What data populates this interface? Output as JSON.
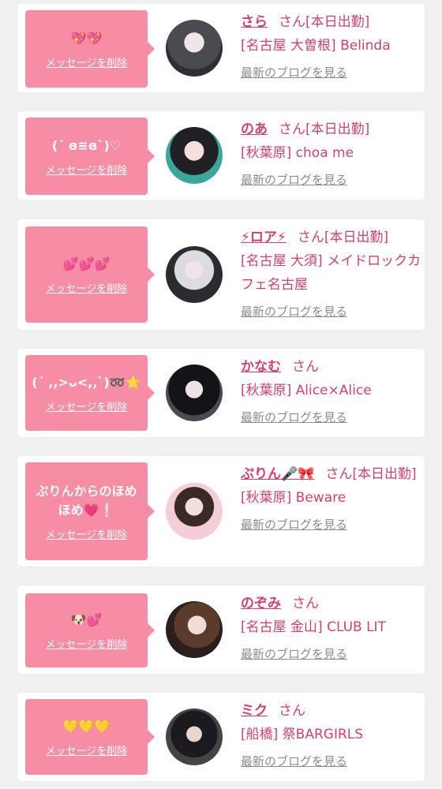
{
  "delete_label": "メッセージを削除",
  "blog_label": "最新のブログを見る",
  "colors": {
    "accent": "#d2416e",
    "bubble": "#f68da4",
    "link_gray": "#8c8c8c",
    "background": "#f0f0f0"
  },
  "items": [
    {
      "message": "💖💖",
      "name": "さら",
      "honorific": "さん",
      "status": "[本日出勤]",
      "shop": "[名古屋 大曽根] Belinda",
      "avatar": "avatar-photo"
    },
    {
      "message": "(ˊ ɞ≡ɞˋ)♡",
      "name": "のあ",
      "honorific": "さん",
      "status": "[本日出勤]",
      "shop": "[秋葉原] choa me",
      "avatar": "avatar-photo"
    },
    {
      "message": "💕💕💕",
      "name": "⚡ロア⚡",
      "honorific": "さん",
      "status": "[本日出勤]",
      "shop": "[名古屋 大須] メイドロックカフェ名古屋",
      "avatar": "avatar-photo"
    },
    {
      "message": "(ˊ ,,>ᴗ<,,ˋ)➿⭐",
      "name": "かなむ",
      "honorific": "さん",
      "status": "",
      "shop": "[秋葉原] Alice×Alice",
      "avatar": "avatar-photo"
    },
    {
      "message": "ぷりんからのほめほめ💗❕",
      "name": "ぷりん🎤🎀",
      "honorific": "さん",
      "status": "[本日出勤]",
      "shop": "[秋葉原] Beware",
      "avatar": "avatar-photo"
    },
    {
      "message": "🐶💕",
      "name": "のぞみ",
      "honorific": "さん",
      "status": "",
      "shop": "[名古屋 金山] CLUB LIT",
      "avatar": "avatar-photo"
    },
    {
      "message": "💛💛💛",
      "name": "ミク",
      "honorific": "さん",
      "status": "",
      "shop": "[船橋] 祭BARGIRLS",
      "avatar": "avatar-photo"
    }
  ]
}
